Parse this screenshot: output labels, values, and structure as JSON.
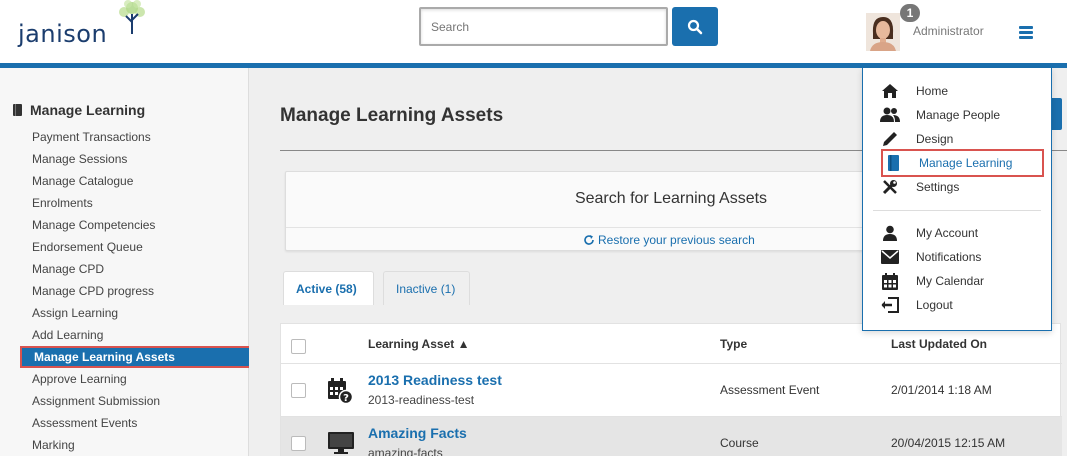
{
  "header": {
    "logo_text": "janison",
    "search_placeholder": "Search",
    "notification_count": "1",
    "user_name": "Administrator"
  },
  "sidebar": {
    "heading": "Manage Learning",
    "items": [
      "Payment Transactions",
      "Manage Sessions",
      "Manage Catalogue",
      "Enrolments",
      "Manage Competencies",
      "Endorsement Queue",
      "Manage CPD",
      "Manage CPD progress",
      "Assign Learning",
      "Add Learning",
      "Manage Learning Assets",
      "Approve Learning",
      "Assignment Submission",
      "Assessment Events",
      "Marking"
    ],
    "active_index": 10
  },
  "main": {
    "page_title": "Manage Learning Assets",
    "search_panel": {
      "title": "Search for Learning Assets",
      "restore_link": "Restore your previous search"
    },
    "tabs": [
      {
        "label": "Active (58)",
        "active": true
      },
      {
        "label": "Inactive (1)",
        "active": false
      }
    ],
    "table": {
      "columns": {
        "asset": "Learning Asset ▲",
        "type": "Type",
        "updated": "Last Updated On"
      },
      "rows": [
        {
          "title": "2013 Readiness test",
          "slug": "2013-readiness-test",
          "type": "Assessment Event",
          "updated": "2/01/2014 1:18 AM",
          "icon": "calendar-question-icon"
        },
        {
          "title": "Amazing Facts",
          "slug": "amazing-facts",
          "type": "Course",
          "updated": "20/04/2015 12:15 AM",
          "icon": "monitor-icon"
        }
      ]
    }
  },
  "menu": {
    "primary": [
      {
        "label": "Home",
        "icon": "home-icon"
      },
      {
        "label": "Manage People",
        "icon": "people-icon"
      },
      {
        "label": "Design",
        "icon": "pencil-icon"
      },
      {
        "label": "Manage Learning",
        "icon": "book-icon"
      },
      {
        "label": "Settings",
        "icon": "tools-icon"
      }
    ],
    "secondary": [
      {
        "label": "My Account",
        "icon": "user-icon"
      },
      {
        "label": "Notifications",
        "icon": "envelope-icon"
      },
      {
        "label": "My Calendar",
        "icon": "calendar-icon"
      },
      {
        "label": "Logout",
        "icon": "logout-icon"
      }
    ],
    "highlighted_index": 3
  },
  "colors": {
    "accent": "#1a6fae",
    "highlight_border": "#d9534f"
  }
}
